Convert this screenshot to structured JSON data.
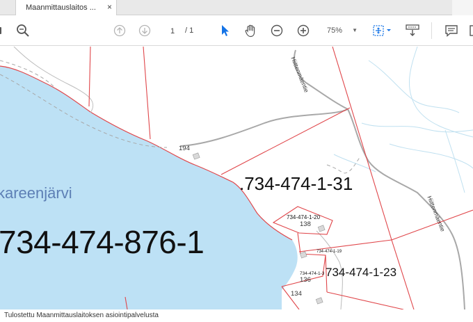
{
  "tab": {
    "title": "Maanmittauslaitos ...",
    "close": "×"
  },
  "toolbar": {
    "page_current": "1",
    "page_total": "/ 1",
    "zoom": "75%",
    "zoom_arrow": "▼"
  },
  "map": {
    "lake_name": "kareenjärvi",
    "parcels": {
      "big": "734-474-876-1",
      "p31": ".734-474-1-31",
      "p23": "734-474-1-23",
      "p20": "734-474-1-20",
      "p19": "734-474-1-19",
      "psmall": "734-474-1-3"
    },
    "numbers": {
      "n194": "194",
      "n138": "138",
      "n136": "136",
      "n134": "134"
    },
    "roads": {
      "top": "Hiittenmäentie",
      "right": "Hiittenmäentie"
    }
  },
  "footer": {
    "text": "Tulostettu Maanmittauslaitoksen asiointipalvelusta"
  }
}
